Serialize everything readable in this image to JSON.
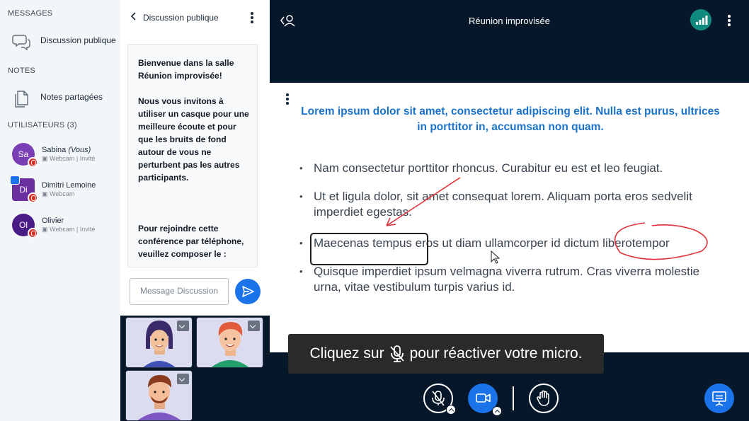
{
  "sidebar": {
    "messages_title": "MESSAGES",
    "public_chat_label": "Discussion publique",
    "notes_title": "NOTES",
    "shared_notes_label": "Notes partagées",
    "users_title": "UTILISATEURS (3)",
    "users": [
      {
        "initials": "Sa",
        "name": "Sabina",
        "you_tag": "(Vous)",
        "status": "Webcam | Invité",
        "color": "#7b3fb5"
      },
      {
        "initials": "Di",
        "name": "Dimitri Lemoine",
        "you_tag": "",
        "status": "Webcam",
        "color": "#6b2fa0"
      },
      {
        "initials": "Ol",
        "name": "Olivier",
        "you_tag": "",
        "status": "Webcam | Invité",
        "color": "#4a1c86"
      }
    ]
  },
  "chat": {
    "title": "Discussion publique",
    "welcome_line1": "Bienvenue dans la salle",
    "welcome_line2": "Réunion improvisée!",
    "headset_text": "Nous vous invitons à utiliser un casque pour une meilleure écoute et pour que les bruits de fond autour de vous ne perturbent pas les autres participants.",
    "phone_text": "Pour rejoindre cette conférence par téléphone, veuillez composer le :",
    "input_placeholder": "Message Discussion"
  },
  "topbar": {
    "title": "Réunion improvisée"
  },
  "slide": {
    "title": "Lorem ipsum dolor sit amet, consectetur adipiscing elit. Nulla est purus, ultrices in porttitor in, accumsan non quam.",
    "bullets": [
      "Nam consectetur porttitor rhoncus. Curabitur eu est et leo feugiat.",
      "Ut et ligula dolor, sit amet consequat lorem. Aliquam porta eros sedvelit imperdiet egestas.",
      "Maecenas tempus eros ut diam ullamcorper id dictum liberotempor",
      "Quisque imperdiet ipsum velmagna viverra rutrum. Cras viverra molestie urna, vitae vestibulum turpis varius id."
    ]
  },
  "toast": {
    "before": "Cliquez sur",
    "after": "pour réactiver votre micro."
  },
  "colors": {
    "accent": "#1a73e8",
    "background": "#06172a",
    "slide_title": "#1a73c8",
    "annotation": "#e0323a",
    "connection": "#0f8a7e"
  }
}
